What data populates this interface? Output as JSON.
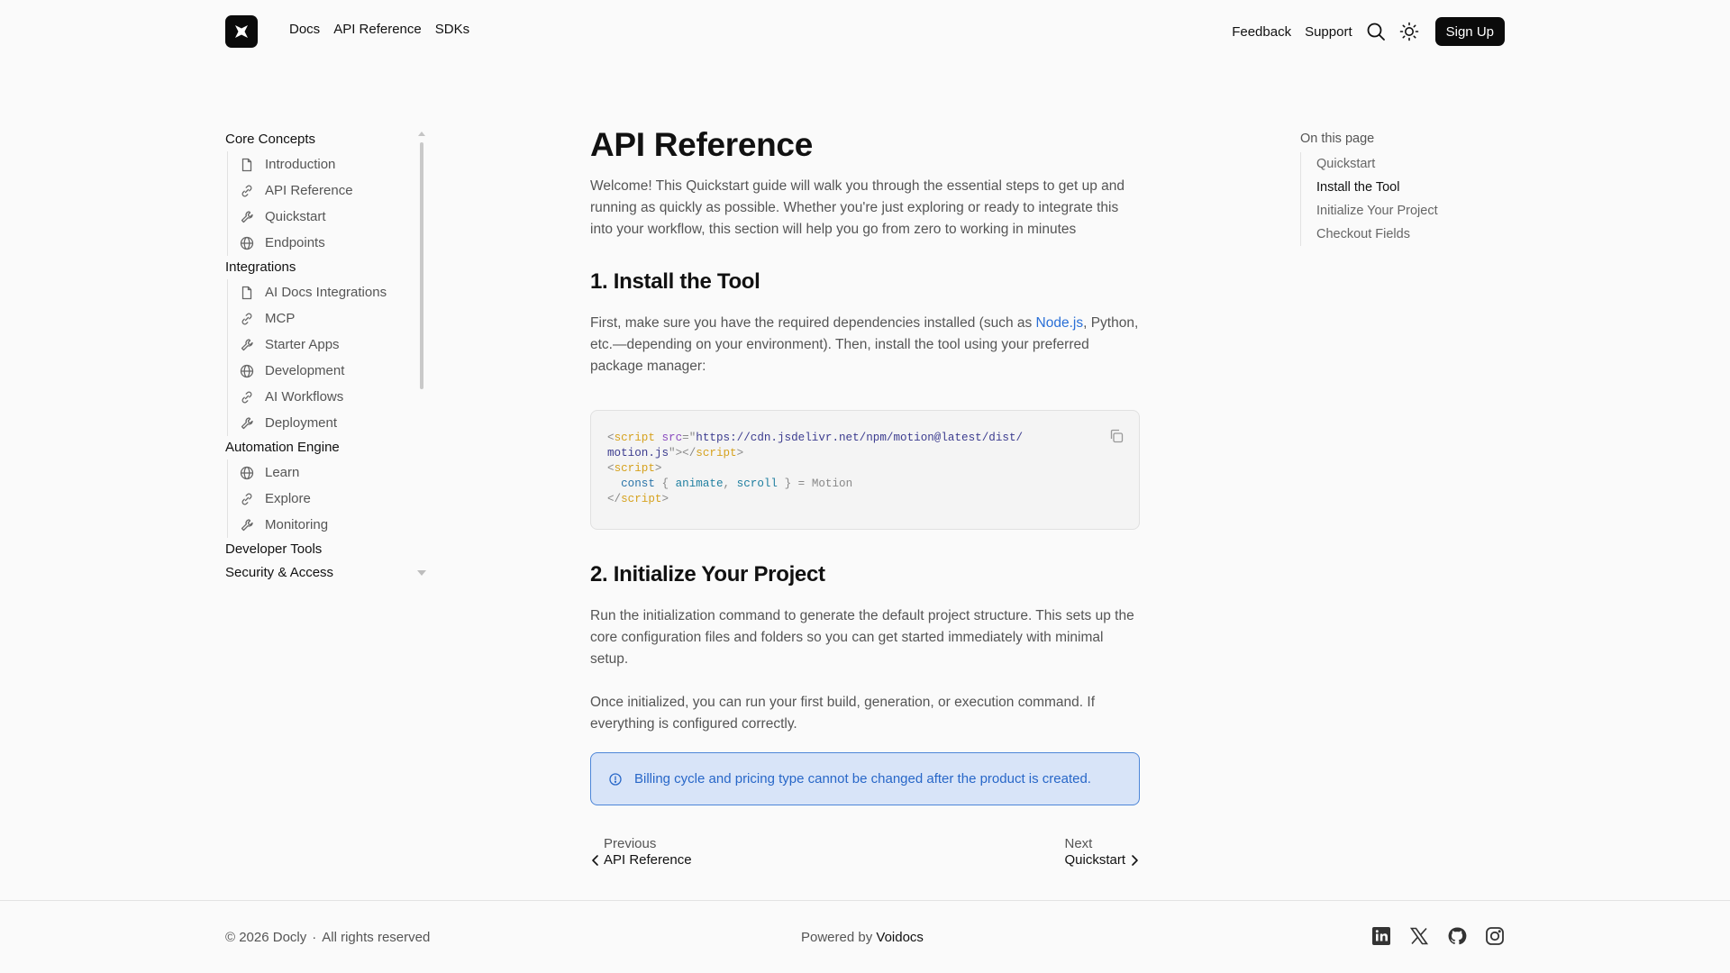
{
  "header": {
    "nav": [
      "Docs",
      "API Reference",
      "SDKs"
    ],
    "feedback": "Feedback",
    "support": "Support",
    "signup": "Sign Up"
  },
  "sidebar": {
    "sections": [
      {
        "title": "Core Concepts",
        "items": [
          {
            "label": "Introduction",
            "icon": "file-icon"
          },
          {
            "label": "API Reference",
            "icon": "link-icon"
          },
          {
            "label": "Quickstart",
            "icon": "wrench-icon"
          },
          {
            "label": "Endpoints",
            "icon": "globe-icon"
          }
        ]
      },
      {
        "title": "Integrations",
        "items": [
          {
            "label": "AI Docs Integrations",
            "icon": "file-icon"
          },
          {
            "label": "MCP",
            "icon": "link-icon"
          },
          {
            "label": "Starter Apps",
            "icon": "wrench-icon"
          },
          {
            "label": "Development",
            "icon": "globe-icon"
          },
          {
            "label": "AI Workflows",
            "icon": "link-icon"
          },
          {
            "label": "Deployment",
            "icon": "wrench-icon"
          }
        ]
      },
      {
        "title": "Automation Engine",
        "items": [
          {
            "label": "Learn",
            "icon": "globe-icon"
          },
          {
            "label": "Explore",
            "icon": "link-icon"
          },
          {
            "label": "Monitoring",
            "icon": "wrench-icon"
          }
        ]
      },
      {
        "title": "Developer Tools",
        "items": []
      },
      {
        "title": "Security & Access",
        "items": []
      }
    ]
  },
  "main": {
    "title": "API Reference",
    "intro": "Welcome! This Quickstart guide will walk you through the essential steps to get up and running as quickly as possible. Whether you're just exploring or ready to integrate this into your workflow, this section will help you go from zero to working in minutes",
    "section1_title": "1. Install the Tool",
    "section1_text_before": "First, make sure you have the required dependencies installed (such as ",
    "section1_link": "Node.js",
    "section1_text_after": ", Python, etc.—depending on your environment). Then, install the tool using your preferred package manager:",
    "code": {
      "src_url_line1": "https://cdn.jsdelivr.net/npm/motion@latest/dist/",
      "src_url_line2": "motion.js",
      "const_kw": "const",
      "var1": "animate",
      "var2": "scroll",
      "rhs": "Motion"
    },
    "section2_title": "2. Initialize Your Project",
    "section2_text1": "Run the initialization command to generate the default project structure. This sets up the core configuration files and folders so you can get started immediately with minimal setup.",
    "section2_text2": "Once initialized, you can run your first build, generation, or execution command. If everything is configured correctly.",
    "callout": "Billing cycle and pricing type cannot be changed after the product is created.",
    "pager": {
      "prev_label": "Previous",
      "prev_title": "API Reference",
      "next_label": "Next",
      "next_title": "Quickstart"
    }
  },
  "toc": {
    "label": "On this page",
    "items": [
      "Quickstart",
      "Install the Tool",
      "Initialize Your Project",
      "Checkout Fields"
    ],
    "active_index": 1
  },
  "footer": {
    "copyright": "© 2026  Docly",
    "dot": "·",
    "rights": "All rights reserved",
    "powered_prefix": "Powered by",
    "powered_brand": "Voidocs",
    "social": [
      "linkedin-icon",
      "x-icon",
      "github-icon",
      "instagram-icon"
    ]
  },
  "colors": {
    "accent_link": "#2a6fd6",
    "callout_bg": "#d8e4f8",
    "callout_border": "#4d86d8",
    "dark_button": "#0b0b0b"
  }
}
